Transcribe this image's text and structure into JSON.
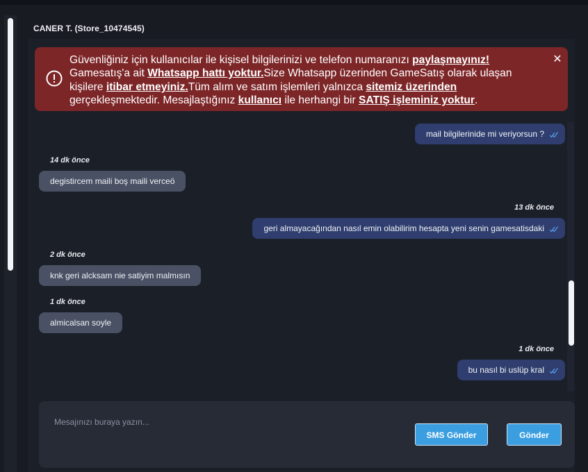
{
  "header": {
    "user_name": "CANER T. (Store_10474545)"
  },
  "warning": {
    "segments": [
      {
        "t": "Güvenliğiniz için kullanıcılar ile kişisel bilgilerinizi ve telefon numaranızı ",
        "b": false
      },
      {
        "t": "paylaşmayınız!",
        "b": true
      },
      {
        "t": " Gamesatış'a ait ",
        "b": false
      },
      {
        "t": "Whatsapp hattı yoktur.",
        "b": true
      },
      {
        "t": "Size Whatsapp üzerinden GameSatış olarak ulaşan kişilere ",
        "b": false
      },
      {
        "t": "itibar etmeyiniz.",
        "b": true
      },
      {
        "t": "Tüm alım ve satım işlemleri yalnızca ",
        "b": false
      },
      {
        "t": "sitemiz üzerinden",
        "b": true
      },
      {
        "t": " gerçekleşmektedir. Mesajlaştığınız ",
        "b": false
      },
      {
        "t": "kullanıcı",
        "b": true
      },
      {
        "t": " ile herhangi bir ",
        "b": false
      },
      {
        "t": "SATIŞ işleminiz yoktur",
        "b": true
      },
      {
        "t": ".",
        "b": false
      }
    ],
    "close_icon": "close-icon",
    "alert_icon": "alert-circle-icon",
    "color": "#7d2628"
  },
  "messages": [
    {
      "dir": "out",
      "text": "mail bilgilerinide mi veriyorsun ?",
      "time": ""
    },
    {
      "dir": "in",
      "text": "degistircem maili boş maili verceö",
      "time": "14 dk önce"
    },
    {
      "dir": "out",
      "text": "geri almayacağından nasıl emin olabilirim hesapta yeni senin gamesatisdaki",
      "time": "13 dk önce"
    },
    {
      "dir": "in",
      "text": "knk geri alcksam nie satiyim malmısın",
      "time": "2 dk önce"
    },
    {
      "dir": "in",
      "text": "almicalsan soyle",
      "time": "1 dk önce"
    },
    {
      "dir": "out",
      "text": "bu nasıl bi uslüp kral",
      "time": "1 dk önce"
    }
  ],
  "composer": {
    "placeholder": "Mesajınızı buraya yazın...",
    "sms_label": "SMS Gönder",
    "send_label": "Gönder"
  },
  "colors": {
    "incoming_bubble": "#4a5164",
    "outgoing_bubble": "#2f3e6e",
    "button": "#3a9ee0"
  }
}
